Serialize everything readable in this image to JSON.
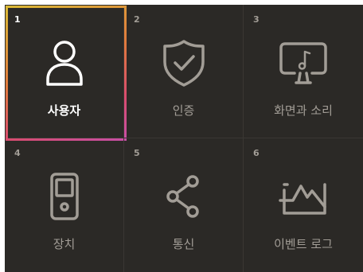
{
  "menu": {
    "tiles": [
      {
        "number": "1",
        "label": "사용자",
        "icon": "user-icon",
        "selected": true
      },
      {
        "number": "2",
        "label": "인증",
        "icon": "shield-check-icon",
        "selected": false
      },
      {
        "number": "3",
        "label": "화면과 소리",
        "icon": "monitor-music-icon",
        "selected": false
      },
      {
        "number": "4",
        "label": "장치",
        "icon": "device-icon",
        "selected": false
      },
      {
        "number": "5",
        "label": "통신",
        "icon": "share-icon",
        "selected": false
      },
      {
        "number": "6",
        "label": "이벤트 로그",
        "icon": "event-log-icon",
        "selected": false
      }
    ]
  },
  "colors": {
    "background": "#2b2926",
    "icon_selected": "#ffffff",
    "icon_default": "#a29d96",
    "selection_gradient": [
      "#d9b935",
      "#e07a3d",
      "#d94c6e",
      "#c74fa6"
    ]
  }
}
